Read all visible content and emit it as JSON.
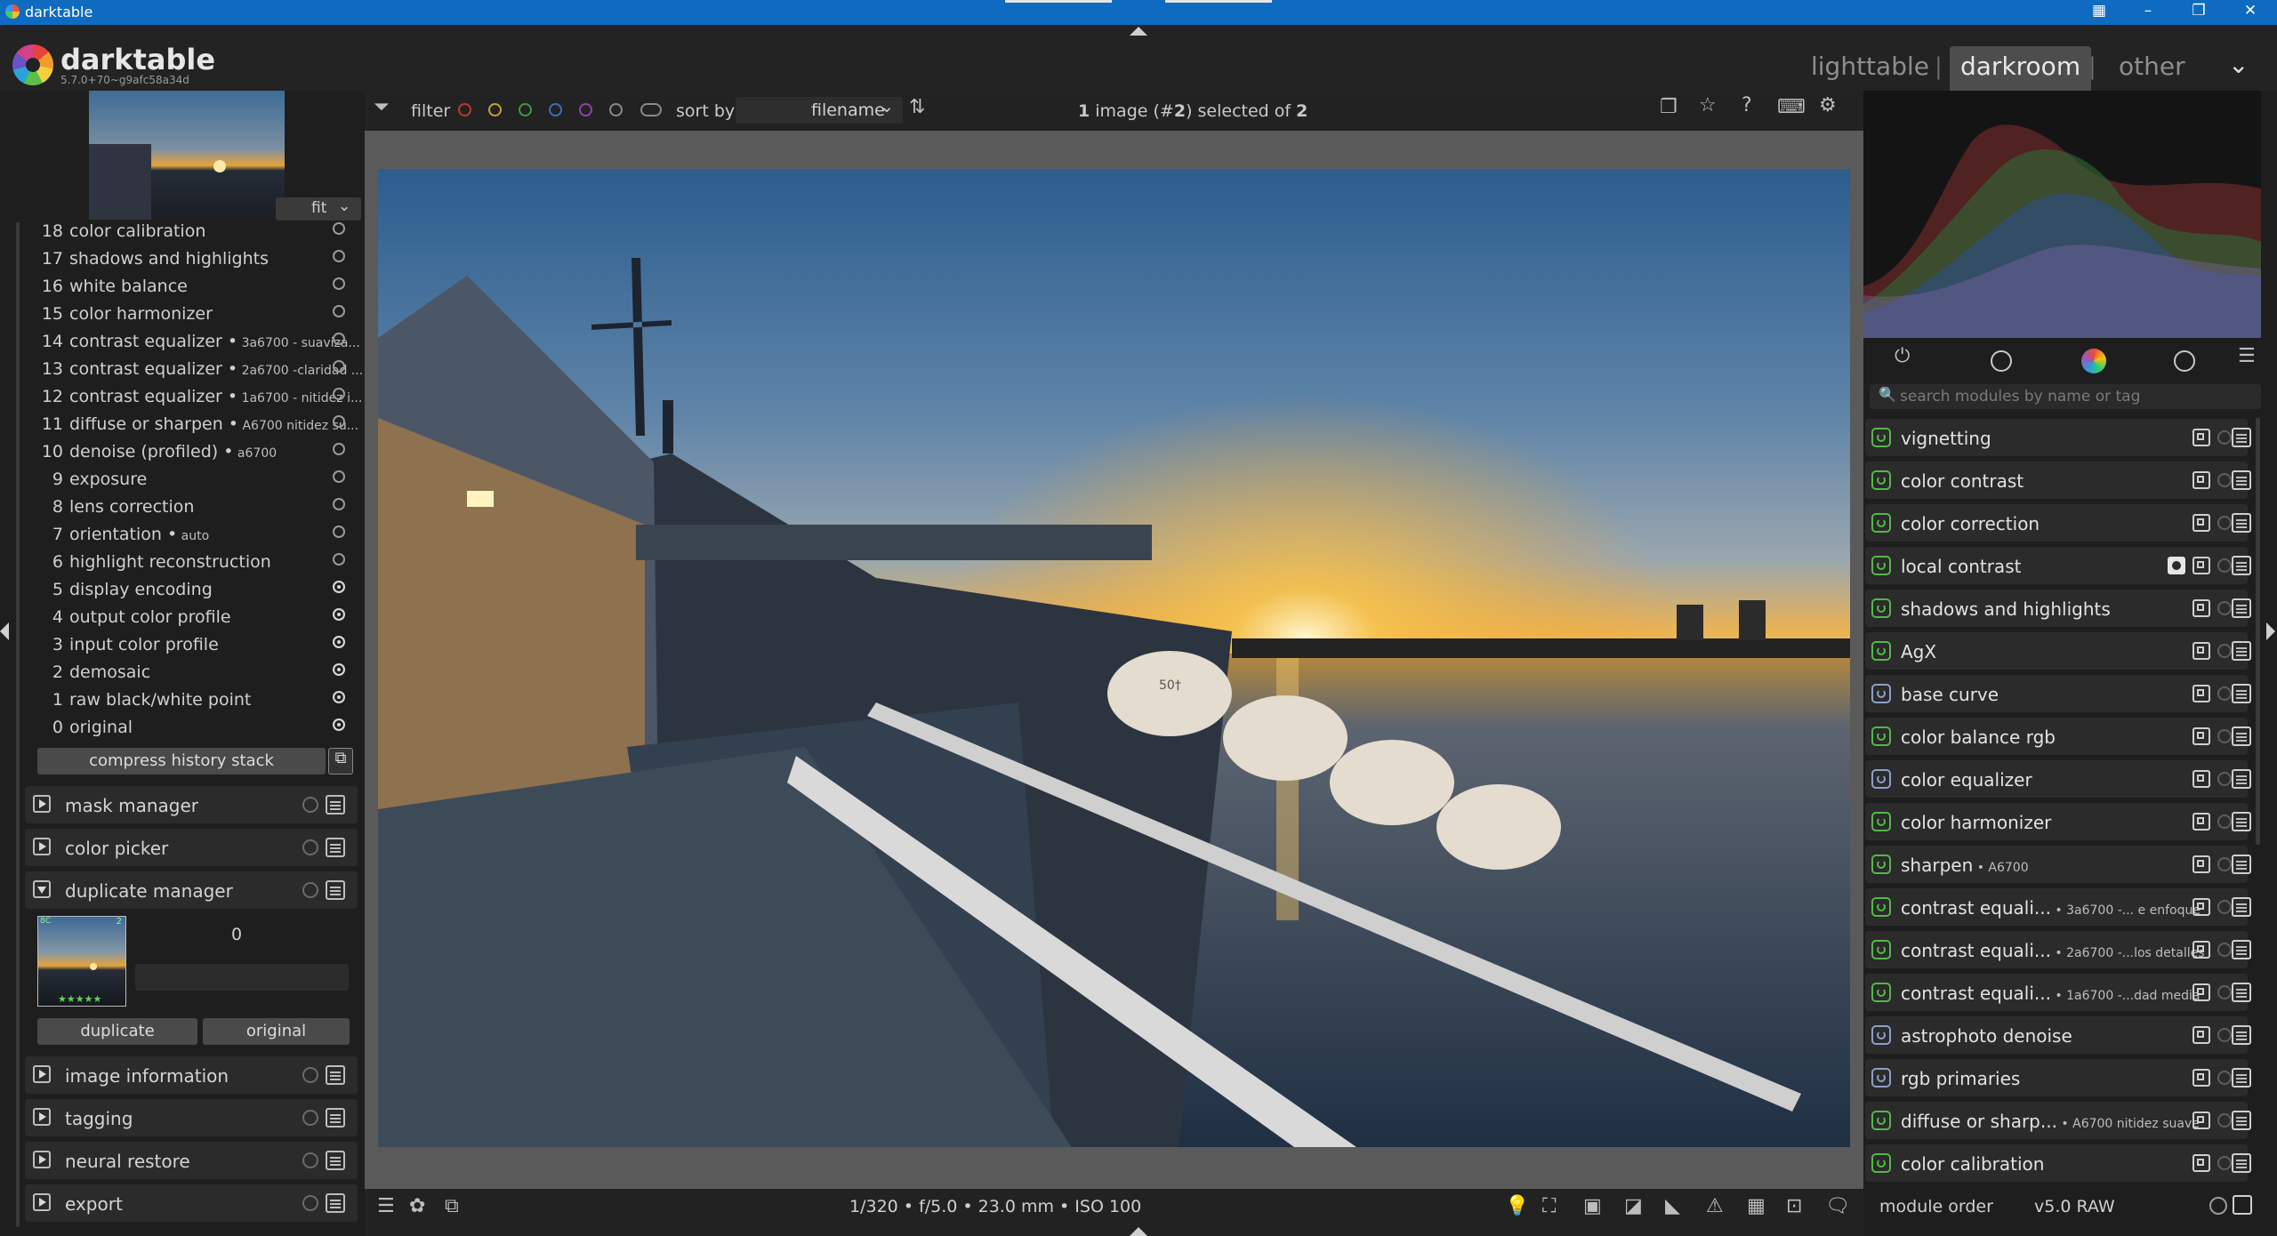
{
  "window": {
    "title": "darktable"
  },
  "header": {
    "app_name": "darktable",
    "version": "5.7.0+70~g9afc58a34d",
    "views": {
      "lighttable": "lighttable",
      "darkroom": "darkroom",
      "other": "other",
      "separator": "|"
    },
    "other_chevron": "⌄"
  },
  "toolbar": {
    "filter_label": "filter",
    "sort_label": "sort by",
    "sort_value": "filename",
    "selection_status_prefix": "1",
    "selection_status_mid": " image (#",
    "selection_status_num": "2",
    "selection_status_suffix": ") selected of ",
    "selection_status_total": "2",
    "color_labels": [
      "#c0392b",
      "#c9a227",
      "#3f9b3f",
      "#3f6fbf",
      "#8e44ad",
      "#8a8a8a"
    ]
  },
  "navigation": {
    "zoom_value": "fit"
  },
  "history": {
    "items": [
      {
        "num": "18",
        "label": "color calibration",
        "sub": "",
        "on": false
      },
      {
        "num": "17",
        "label": "shadows and highlights",
        "sub": "",
        "on": false
      },
      {
        "num": "16",
        "label": "white balance",
        "sub": "",
        "on": false
      },
      {
        "num": "15",
        "label": "color harmonizer",
        "sub": "",
        "on": false
      },
      {
        "num": "14",
        "label": "contrast equalizer •",
        "sub": " 3a6700 - suaviza...",
        "on": false
      },
      {
        "num": "13",
        "label": "contrast equalizer •",
        "sub": " 2a6700 -claridad ...",
        "on": false
      },
      {
        "num": "12",
        "label": "contrast equalizer •",
        "sub": " 1a6700 - nitidez i...",
        "on": false
      },
      {
        "num": "11",
        "label": "diffuse or sharpen •",
        "sub": " A6700 nitidez su...",
        "on": false
      },
      {
        "num": "10",
        "label": "denoise (profiled) •",
        "sub": " a6700",
        "on": false
      },
      {
        "num": "9",
        "label": "exposure",
        "sub": "",
        "on": false
      },
      {
        "num": "8",
        "label": "lens correction",
        "sub": "",
        "on": false
      },
      {
        "num": "7",
        "label": "orientation •",
        "sub": " auto",
        "on": false
      },
      {
        "num": "6",
        "label": "highlight reconstruction",
        "sub": "",
        "on": false
      },
      {
        "num": "5",
        "label": "display encoding",
        "sub": "",
        "on": true
      },
      {
        "num": "4",
        "label": "output color profile",
        "sub": "",
        "on": true
      },
      {
        "num": "3",
        "label": "input color profile",
        "sub": "",
        "on": true
      },
      {
        "num": "2",
        "label": "demosaic",
        "sub": "",
        "on": true
      },
      {
        "num": "1",
        "label": "raw black/white point",
        "sub": "",
        "on": true
      },
      {
        "num": "0",
        "label": "original",
        "sub": "",
        "on": true
      }
    ],
    "compress_label": "compress history stack"
  },
  "left_modules": {
    "mask_manager": "mask manager",
    "color_picker": "color picker",
    "duplicate_manager": "duplicate manager",
    "image_information": "image information",
    "tagging": "tagging",
    "neural_restore": "neural restore",
    "export": "export"
  },
  "duplicate": {
    "version_number": "0",
    "thumb_badge_left": "8C",
    "thumb_badge_right": "2",
    "stars": "★★★★★",
    "duplicate_button": "duplicate",
    "original_button": "original"
  },
  "image_info": {
    "exif": "1/320 • f/5.0 • 23.0 mm • ISO 100"
  },
  "right_panel": {
    "search_placeholder": "search modules by name or tag",
    "modules": [
      {
        "label": "vignetting",
        "sub": "",
        "on": true,
        "mask": false
      },
      {
        "label": "color contrast",
        "sub": "",
        "on": true,
        "mask": false
      },
      {
        "label": "color correction",
        "sub": "",
        "on": true,
        "mask": false
      },
      {
        "label": "local contrast",
        "sub": "",
        "on": true,
        "mask": true
      },
      {
        "label": "shadows and highlights",
        "sub": "",
        "on": true,
        "mask": false
      },
      {
        "label": "AgX",
        "sub": "",
        "on": true,
        "mask": false
      },
      {
        "label": "base curve",
        "sub": "",
        "on": false,
        "mask": false
      },
      {
        "label": "color balance rgb",
        "sub": "",
        "on": true,
        "mask": false
      },
      {
        "label": "color equalizer",
        "sub": "",
        "on": false,
        "mask": false
      },
      {
        "label": "color harmonizer",
        "sub": "",
        "on": true,
        "mask": false
      },
      {
        "label": "sharpen",
        "sub": " • A6700",
        "on": true,
        "mask": false
      },
      {
        "label": "contrast equali...",
        "sub": " • 3a6700 -... e enfoque",
        "on": true,
        "mask": false
      },
      {
        "label": "contrast equali...",
        "sub": " • 2a6700 -...los detalles",
        "on": true,
        "mask": false
      },
      {
        "label": "contrast equali...",
        "sub": " • 1a6700 -...dad media",
        "on": true,
        "mask": false
      },
      {
        "label": "astrophoto denoise",
        "sub": "",
        "on": false,
        "mask": false
      },
      {
        "label": "rgb primaries",
        "sub": "",
        "on": false,
        "mask": false
      },
      {
        "label": "diffuse or sharp...",
        "sub": " • A6700 nitidez suave",
        "on": true,
        "mask": false
      },
      {
        "label": "color calibration",
        "sub": "",
        "on": true,
        "mask": false
      }
    ],
    "module_order_label": "module order",
    "module_order_value": "v5.0 RAW"
  },
  "photo": {
    "lifeboat_label": "50†"
  },
  "colors": {
    "accent_power": "#54b848",
    "accent_off": "#8aa0c8",
    "titlebar": "#0f6bbf"
  }
}
